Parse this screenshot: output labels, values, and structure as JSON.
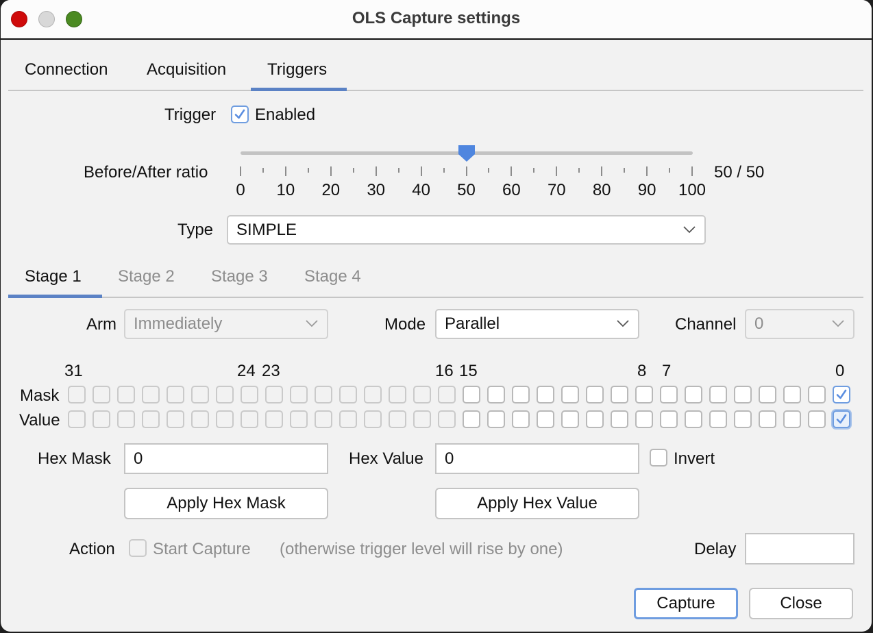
{
  "window": {
    "title": "OLS Capture settings",
    "controls": [
      "close",
      "minimize",
      "maximize"
    ]
  },
  "main_tabs": [
    {
      "label": "Connection",
      "active": false
    },
    {
      "label": "Acquisition",
      "active": false
    },
    {
      "label": "Triggers",
      "active": true
    }
  ],
  "trigger": {
    "label": "Trigger",
    "enabled_label": "Enabled",
    "enabled": true
  },
  "ratio": {
    "label": "Before/After ratio",
    "value": 50,
    "min": 0,
    "max": 100,
    "tick_labels": [
      "0",
      "10",
      "20",
      "30",
      "40",
      "50",
      "60",
      "70",
      "80",
      "90",
      "100"
    ],
    "readout": "50 / 50"
  },
  "type": {
    "label": "Type",
    "value": "SIMPLE"
  },
  "stage_tabs": [
    {
      "label": "Stage 1",
      "active": true
    },
    {
      "label": "Stage 2",
      "active": false
    },
    {
      "label": "Stage 3",
      "active": false
    },
    {
      "label": "Stage 4",
      "active": false
    }
  ],
  "stage": {
    "arm": {
      "label": "Arm",
      "value": "Immediately",
      "disabled": true
    },
    "mode": {
      "label": "Mode",
      "value": "Parallel",
      "disabled": false
    },
    "channel": {
      "label": "Channel",
      "value": "0",
      "disabled": true
    },
    "bit_labels": {
      "b31": "31",
      "b24": "24",
      "b23": "23",
      "b16": "16",
      "b15": "15",
      "b8": "8",
      "b7": "7",
      "b0": "0"
    },
    "mask_label": "Mask",
    "value_label": "Value",
    "mask_bits_checked": [
      0
    ],
    "value_bits_checked": [
      0
    ],
    "disabled_bits_from": 16,
    "hex_mask": {
      "label": "Hex Mask",
      "value": "0"
    },
    "hex_value": {
      "label": "Hex Value",
      "value": "0"
    },
    "invert": {
      "label": "Invert",
      "checked": false
    },
    "apply_mask_label": "Apply Hex Mask",
    "apply_value_label": "Apply Hex Value",
    "action": {
      "label": "Action",
      "start_capture_label": "Start Capture",
      "start_capture_checked": false,
      "note": "(otherwise trigger level will rise by one)"
    },
    "delay": {
      "label": "Delay",
      "value": ""
    }
  },
  "footer": {
    "capture_label": "Capture",
    "close_label": "Close"
  },
  "colors": {
    "accent": "#5b82c5",
    "checkbox_accent": "#6f9de0",
    "background": "#f2f2f2"
  }
}
